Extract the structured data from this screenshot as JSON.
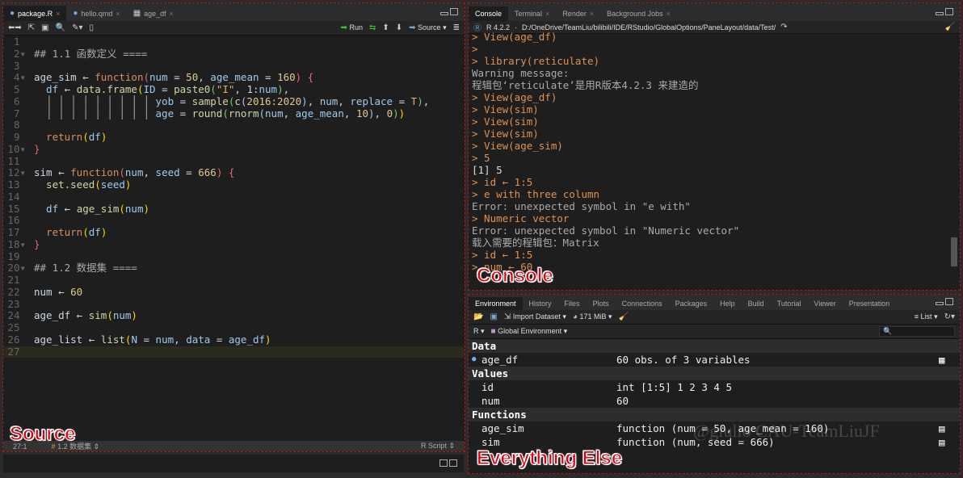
{
  "source": {
    "tabs": [
      {
        "label": "package.R",
        "active": true
      },
      {
        "label": "hello.qmd"
      },
      {
        "label": "age_df"
      }
    ],
    "toolbar": {
      "run": "Run",
      "source": "Source"
    },
    "lines": [
      [],
      [
        [
          "## 1.1 函数定义 ====",
          "c"
        ]
      ],
      [],
      [
        [
          "age_sim",
          "t"
        ],
        [
          " ← ",
          "t"
        ],
        [
          "function",
          "k"
        ],
        [
          "(",
          "r"
        ],
        [
          "num",
          "v"
        ],
        [
          " = ",
          "t"
        ],
        [
          "50",
          "n"
        ],
        [
          ", ",
          "t"
        ],
        [
          "age_mean",
          "v"
        ],
        [
          " = ",
          "t"
        ],
        [
          "160",
          "n"
        ],
        [
          ") {",
          "r"
        ]
      ],
      [
        [
          "  df",
          "v"
        ],
        [
          " ← ",
          "t"
        ],
        [
          "data.frame",
          "f"
        ],
        [
          "(",
          "p"
        ],
        [
          "ID",
          "v"
        ],
        [
          " = ",
          "t"
        ],
        [
          "paste0",
          "f"
        ],
        [
          "(",
          "g"
        ],
        [
          "\"I\"",
          "s"
        ],
        [
          ", 1:",
          "t"
        ],
        [
          "num",
          "v"
        ],
        [
          ")",
          "g"
        ],
        [
          ",",
          "t"
        ]
      ],
      [
        [
          "  │ │ │ │ │ │ │ │ │ ",
          "c"
        ],
        [
          "yob",
          "v"
        ],
        [
          " = ",
          "t"
        ],
        [
          "sample",
          "f"
        ],
        [
          "(",
          "g"
        ],
        [
          "c",
          "f"
        ],
        [
          "(",
          "v"
        ],
        [
          "2016:2020",
          "n"
        ],
        [
          ")",
          "v"
        ],
        [
          ", ",
          "t"
        ],
        [
          "num",
          "v"
        ],
        [
          ", ",
          "t"
        ],
        [
          "replace",
          "v"
        ],
        [
          " = ",
          "t"
        ],
        [
          "T",
          "s"
        ],
        [
          ")",
          "g"
        ],
        [
          ",",
          "t"
        ]
      ],
      [
        [
          "  │ │ │ │ │ │ │ │ │ ",
          "c"
        ],
        [
          "age",
          "v"
        ],
        [
          " = ",
          "t"
        ],
        [
          "round",
          "f"
        ],
        [
          "(",
          "g"
        ],
        [
          "rnorm",
          "f"
        ],
        [
          "(",
          "v"
        ],
        [
          "num",
          "v"
        ],
        [
          ", ",
          "t"
        ],
        [
          "age_mean",
          "v"
        ],
        [
          ", ",
          "t"
        ],
        [
          "10",
          "n"
        ],
        [
          ")",
          "v"
        ],
        [
          ", ",
          "t"
        ],
        [
          "0",
          "n"
        ],
        [
          ")",
          "g"
        ],
        [
          ")",
          "p"
        ]
      ],
      [],
      [
        [
          "  return",
          "k"
        ],
        [
          "(",
          "p"
        ],
        [
          "df",
          "v"
        ],
        [
          ")",
          "p"
        ]
      ],
      [
        [
          "}",
          "r"
        ]
      ],
      [],
      [
        [
          "sim",
          "t"
        ],
        [
          " ← ",
          "t"
        ],
        [
          "function",
          "k"
        ],
        [
          "(",
          "r"
        ],
        [
          "num",
          "v"
        ],
        [
          ", ",
          "t"
        ],
        [
          "seed",
          "v"
        ],
        [
          " = ",
          "t"
        ],
        [
          "666",
          "n"
        ],
        [
          ") {",
          "r"
        ]
      ],
      [
        [
          "  set.seed",
          "f"
        ],
        [
          "(",
          "p"
        ],
        [
          "seed",
          "v"
        ],
        [
          ")",
          "p"
        ]
      ],
      [],
      [
        [
          "  df",
          "v"
        ],
        [
          " ← ",
          "t"
        ],
        [
          "age_sim",
          "f"
        ],
        [
          "(",
          "p"
        ],
        [
          "num",
          "v"
        ],
        [
          ")",
          "p"
        ]
      ],
      [],
      [
        [
          "  return",
          "k"
        ],
        [
          "(",
          "p"
        ],
        [
          "df",
          "v"
        ],
        [
          ")",
          "p"
        ]
      ],
      [
        [
          "}",
          "r"
        ]
      ],
      [],
      [
        [
          "## 1.2 数据集 ====",
          "c"
        ]
      ],
      [],
      [
        [
          "num",
          "t"
        ],
        [
          " ← ",
          "t"
        ],
        [
          "60",
          "n"
        ]
      ],
      [],
      [
        [
          "age_df",
          "t"
        ],
        [
          " ← ",
          "t"
        ],
        [
          "sim",
          "f"
        ],
        [
          "(",
          "p"
        ],
        [
          "num",
          "v"
        ],
        [
          ")",
          "p"
        ]
      ],
      [],
      [
        [
          "age_list",
          "t"
        ],
        [
          " ← ",
          "t"
        ],
        [
          "list",
          "f"
        ],
        [
          "(",
          "p"
        ],
        [
          "N",
          "v"
        ],
        [
          " = ",
          "t"
        ],
        [
          "num",
          "v"
        ],
        [
          ", ",
          "t"
        ],
        [
          "data",
          "v"
        ],
        [
          " = ",
          "t"
        ],
        [
          "age_df",
          "v"
        ],
        [
          ")",
          "p"
        ]
      ],
      []
    ],
    "status": {
      "position": "27:1",
      "section": "1.2 数据集",
      "filetype": "R Script"
    },
    "region_label": "Source"
  },
  "console": {
    "tabs": [
      "Console",
      "Terminal",
      "Render",
      "Background Jobs"
    ],
    "version": "R 4.2.2",
    "path": "D:/OneDrive/TeamLiu/bilibili/IDE/RStudio/GlobalOptions/PaneLayout/data/Test/",
    "lines": [
      [
        "> View(age_df)",
        "cmd"
      ],
      [
        ">",
        "cmd"
      ],
      [
        "> library(reticulate)",
        "cmd"
      ],
      [
        "Warning message:",
        "warn"
      ],
      [
        "程辑包‘reticulate’是用R版本4.2.3 来建造的",
        "warn"
      ],
      [
        "> View(age_df)",
        "cmd"
      ],
      [
        "> View(sim)",
        "cmd"
      ],
      [
        "> View(sim)",
        "cmd"
      ],
      [
        "> View(sim)",
        "cmd"
      ],
      [
        "> View(age_sim)",
        "cmd"
      ],
      [
        "> 5",
        "cmd"
      ],
      [
        "[1] 5",
        "out"
      ],
      [
        "> id ← 1:5",
        "cmd"
      ],
      [
        "> e with three column",
        "cmd"
      ],
      [
        "Error: unexpected symbol in \"e with\"",
        "warn"
      ],
      [
        "> Numeric vector",
        "cmd"
      ],
      [
        "Error: unexpected symbol in \"Numeric vector\"",
        "warn"
      ],
      [
        "载入需要的程辑包：Matrix",
        "warn"
      ],
      [
        "> id ← 1:5",
        "cmd"
      ],
      [
        "> num ← 60",
        "cmd"
      ]
    ],
    "region_label": "Console"
  },
  "env": {
    "tabs": [
      "Environment",
      "History",
      "Files",
      "Plots",
      "Connections",
      "Packages",
      "Help",
      "Build",
      "Tutorial",
      "Viewer",
      "Presentation"
    ],
    "toolbar": {
      "import": "Import Dataset",
      "memory": "171 MiB",
      "view": "List",
      "lang": "R",
      "scope": "Global Environment"
    },
    "sections": [
      {
        "title": "Data",
        "rows": [
          [
            "age_df",
            "60 obs. of 3 variables"
          ]
        ]
      },
      {
        "title": "Values",
        "rows": [
          [
            "id",
            "int [1:5] 1 2 3 4 5"
          ],
          [
            "num",
            "60"
          ]
        ]
      },
      {
        "title": "Functions",
        "rows": [
          [
            "age_sim",
            "function (num = 50, age_mean = 160)"
          ],
          [
            "sim",
            "function (num, seed = 666)"
          ]
        ]
      }
    ],
    "watermark": "@giulio CAU-TeamLiuJF",
    "region_label": "Everything Else"
  }
}
